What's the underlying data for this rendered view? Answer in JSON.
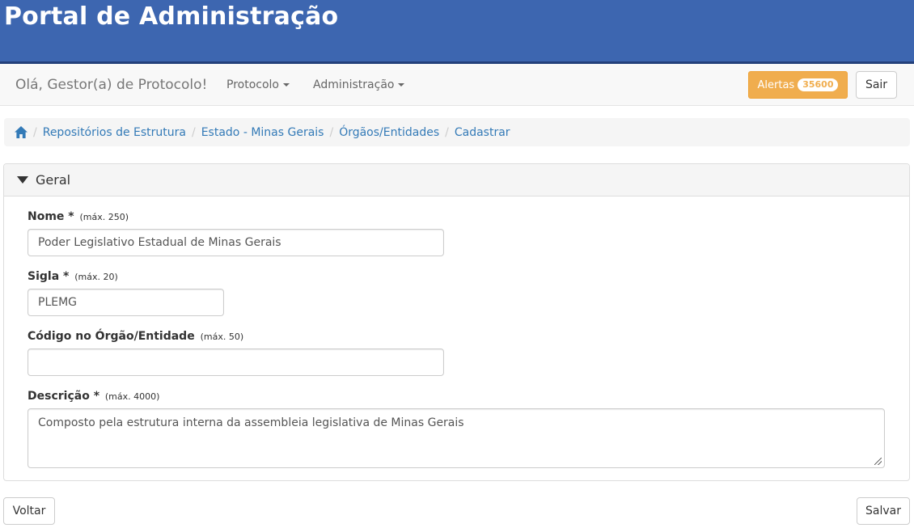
{
  "banner": {
    "title": "Portal de Administração"
  },
  "navbar": {
    "greeting": "Olá, Gestor(a) de Protocolo!",
    "menus": [
      "Protocolo",
      "Administração"
    ],
    "alertas_label": "Alertas",
    "alertas_count": "35600",
    "sair_label": "Sair"
  },
  "breadcrumb": {
    "items": [
      "Repositórios de Estrutura",
      "Estado - Minas Gerais",
      "Órgãos/Entidades",
      "Cadastrar"
    ]
  },
  "panel": {
    "heading": "Geral",
    "fields": [
      {
        "label": "Nome *",
        "hint": "(máx. 250)",
        "value": "Poder Legislativo Estadual de Minas Gerais"
      },
      {
        "label": "Sigla *",
        "hint": "(máx. 20)",
        "value": "PLEMG"
      },
      {
        "label": "Código no Órgão/Entidade",
        "hint": "(máx. 50)",
        "value": ""
      },
      {
        "label": "Descrição *",
        "hint": "(máx. 4000)",
        "value": "Composto pela estrutura interna da assembleia legislativa de Minas Gerais"
      }
    ]
  },
  "footer": {
    "voltar_label": "Voltar",
    "salvar_label": "Salvar"
  },
  "colors": {
    "banner": "#3d66b0",
    "link": "#337ab7",
    "warning": "#f0ad4e"
  }
}
